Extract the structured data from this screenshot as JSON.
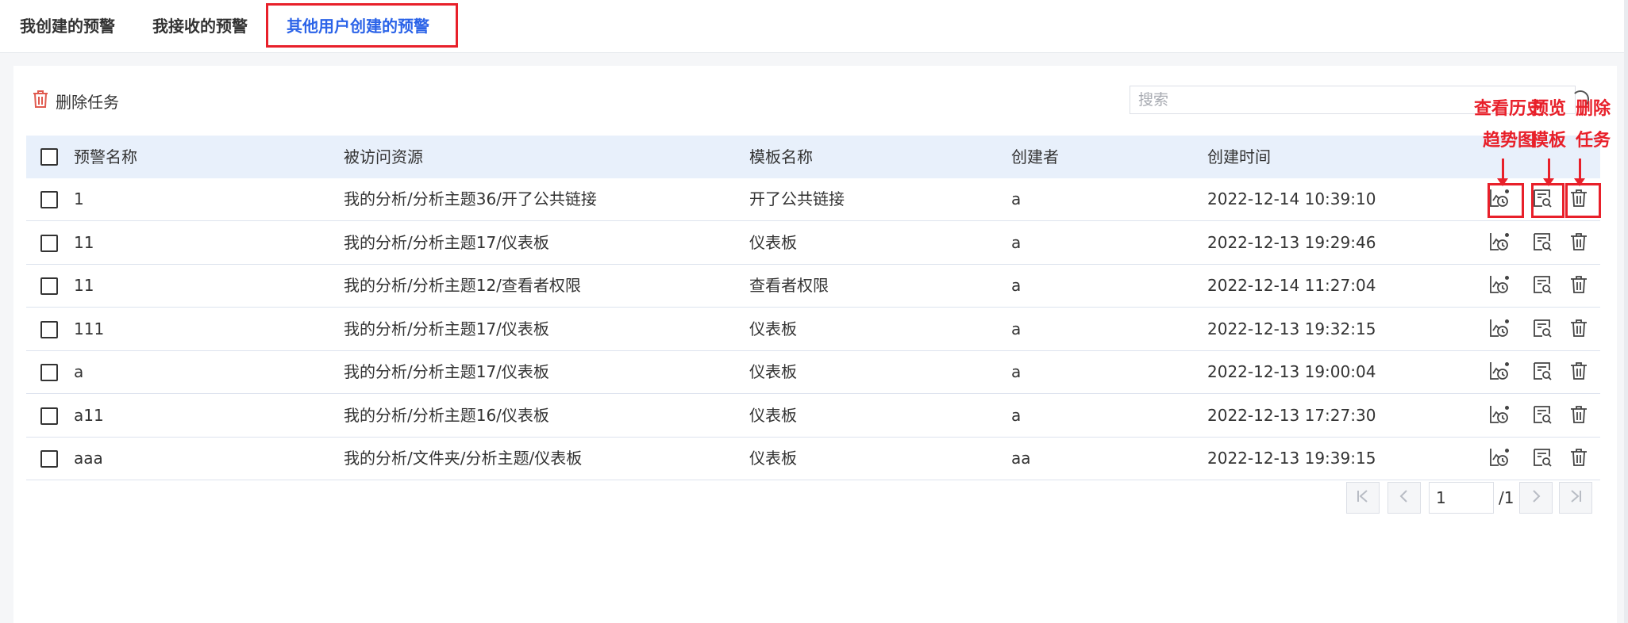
{
  "tabs": [
    {
      "label": "我创建的预警",
      "active": false
    },
    {
      "label": "我接收的预警",
      "active": false
    },
    {
      "label": "其他用户创建的预警",
      "active": true
    }
  ],
  "toolbar": {
    "delete_label": "删除任务"
  },
  "search": {
    "placeholder": "搜索",
    "value": ""
  },
  "table": {
    "columns": [
      "预警名称",
      "被访问资源",
      "模板名称",
      "创建者",
      "创建时间"
    ],
    "rows": [
      {
        "name": "1",
        "resource": "我的分析/分析主题36/开了公共链接",
        "template": "开了公共链接",
        "creator": "a",
        "created": "2022-12-14 10:39:10"
      },
      {
        "name": "11",
        "resource": "我的分析/分析主题17/仪表板",
        "template": "仪表板",
        "creator": "a",
        "created": "2022-12-13 19:29:46"
      },
      {
        "name": "11",
        "resource": "我的分析/分析主题12/查看者权限",
        "template": "查看者权限",
        "creator": "a",
        "created": "2022-12-14 11:27:04"
      },
      {
        "name": "111",
        "resource": "我的分析/分析主题17/仪表板",
        "template": "仪表板",
        "creator": "a",
        "created": "2022-12-13 19:32:15"
      },
      {
        "name": "a",
        "resource": "我的分析/分析主题17/仪表板",
        "template": "仪表板",
        "creator": "a",
        "created": "2022-12-13 19:00:04"
      },
      {
        "name": "a11",
        "resource": "我的分析/分析主题16/仪表板",
        "template": "仪表板",
        "creator": "a",
        "created": "2022-12-13 17:27:30"
      },
      {
        "name": "aaa",
        "resource": "我的分析/文件夹/分析主题/仪表板",
        "template": "仪表板",
        "creator": "aa",
        "created": "2022-12-13 19:39:15"
      }
    ],
    "row_actions": [
      "trend-history-icon",
      "template-preview-icon",
      "delete-icon"
    ]
  },
  "annotations": {
    "trend_line1": "查看历史",
    "trend_line2": "趋势图",
    "preview_line1": "预览",
    "preview_line2": "模板",
    "delete_line1": "删除",
    "delete_line2": "任务"
  },
  "pagination": {
    "current": "1",
    "total": "/1"
  },
  "colors": {
    "accent": "#2b63e8",
    "annotation_red": "#e8202a",
    "header_bg": "#e8f0fb",
    "delete_icon": "#e05a4f"
  }
}
